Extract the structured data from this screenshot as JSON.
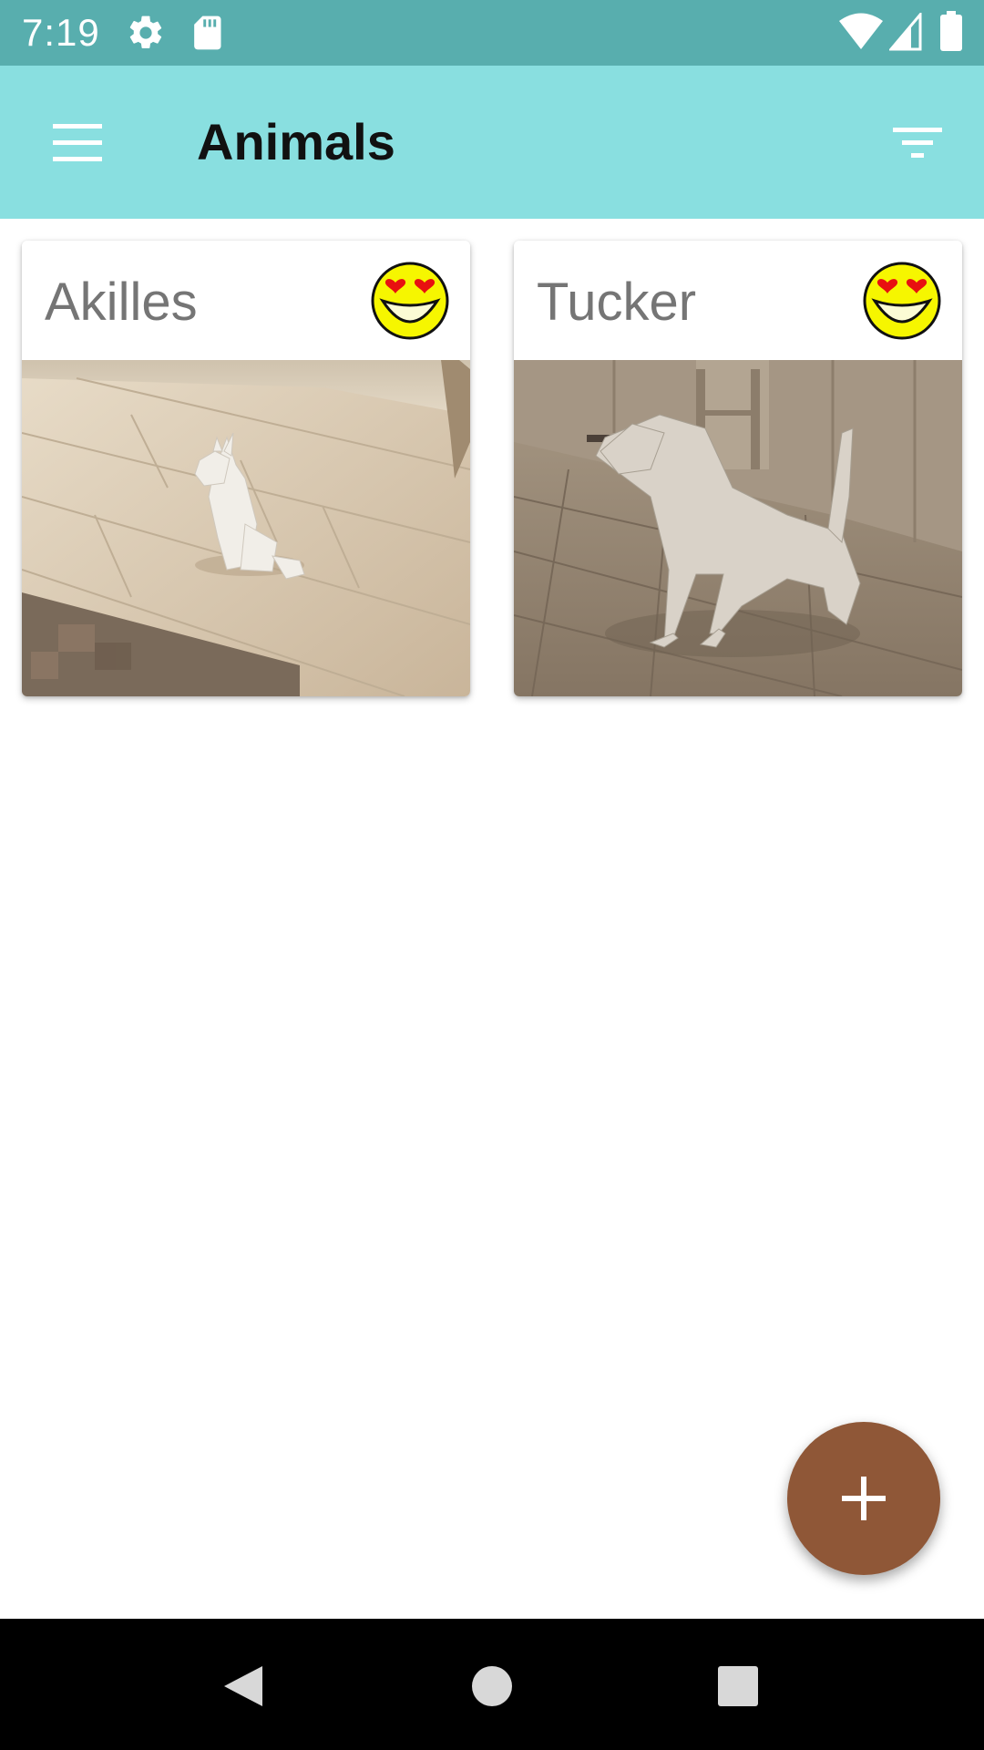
{
  "status_bar": {
    "time": "7:19",
    "icons": [
      "settings-icon",
      "sd-card-icon",
      "wifi-icon",
      "cell-signal-icon",
      "battery-icon"
    ]
  },
  "toolbar": {
    "title": "Animals",
    "menu_icon": "hamburger-menu-icon",
    "filter_icon": "filter-icon"
  },
  "animals": [
    {
      "name": "Akilles",
      "mood_icon": "heart-eyes-smiley-icon",
      "photo": "low-poly white cat sitting on wooden floor"
    },
    {
      "name": "Tucker",
      "mood_icon": "heart-eyes-smiley-icon",
      "photo": "low-poly white dog standing on wooden floor"
    }
  ],
  "fab": {
    "icon": "plus-icon"
  },
  "nav_bar": {
    "icons": [
      "back-icon",
      "home-icon",
      "recents-icon"
    ]
  },
  "colors": {
    "status_bar": "#58aeae",
    "toolbar": "#89dfe0",
    "fab": "#8f5737",
    "card_title": "#757575",
    "emoji_yellow": "#f6f600"
  }
}
